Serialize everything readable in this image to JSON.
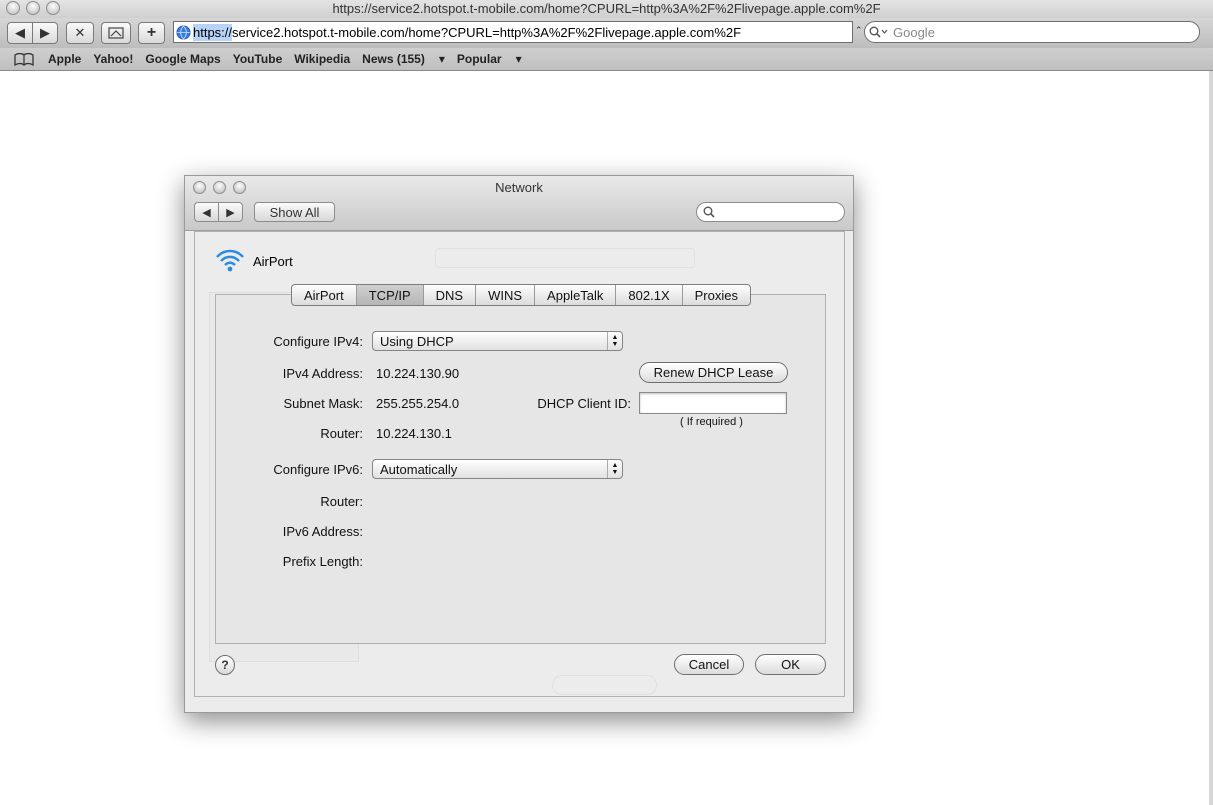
{
  "browser": {
    "window_title": "https://service2.hotspot.t-mobile.com/home?CPURL=http%3A%2F%2Flivepage.apple.com%2F",
    "url_scheme": "https://",
    "url_rest": "service2.hotspot.t-mobile.com/home?CPURL=http%3A%2F%2Flivepage.apple.com%2F",
    "search_placeholder": "Google",
    "bookmarks": [
      "Apple",
      "Yahoo!",
      "Google Maps",
      "YouTube",
      "Wikipedia",
      "News (155)",
      "Popular"
    ],
    "bookmark_dropdown_arrow": "▾"
  },
  "network_window": {
    "title": "Network",
    "show_all_label": "Show All",
    "interface_name": "AirPort",
    "tabs": [
      "AirPort",
      "TCP/IP",
      "DNS",
      "WINS",
      "AppleTalk",
      "802.1X",
      "Proxies"
    ],
    "active_tab": "TCP/IP",
    "tcpip": {
      "configure_ipv4_label": "Configure IPv4:",
      "configure_ipv4_value": "Using DHCP",
      "ipv4_address_label": "IPv4 Address:",
      "ipv4_address_value": "10.224.130.90",
      "subnet_mask_label": "Subnet Mask:",
      "subnet_mask_value": "255.255.254.0",
      "router_label": "Router:",
      "router_value": "10.224.130.1",
      "renew_dhcp_label": "Renew DHCP Lease",
      "dhcp_client_id_label": "DHCP Client ID:",
      "dhcp_client_id_value": "",
      "if_required_note": "( If required )",
      "configure_ipv6_label": "Configure IPv6:",
      "configure_ipv6_value": "Automatically",
      "ipv6_router_label": "Router:",
      "ipv6_address_label": "IPv6 Address:",
      "prefix_length_label": "Prefix Length:"
    },
    "help_label": "?",
    "cancel_label": "Cancel",
    "ok_label": "OK"
  },
  "icons": [
    "back-arrow-icon",
    "forward-arrow-icon",
    "stop-icon",
    "snapback-icon",
    "add-bookmark-icon",
    "globe-icon",
    "search-icon",
    "book-icon",
    "wifi-icon"
  ],
  "colors": {
    "url_selection": "#b7d3f7",
    "wifi_blue": "#2a8be0",
    "active_tab": "#bdbdbd"
  }
}
